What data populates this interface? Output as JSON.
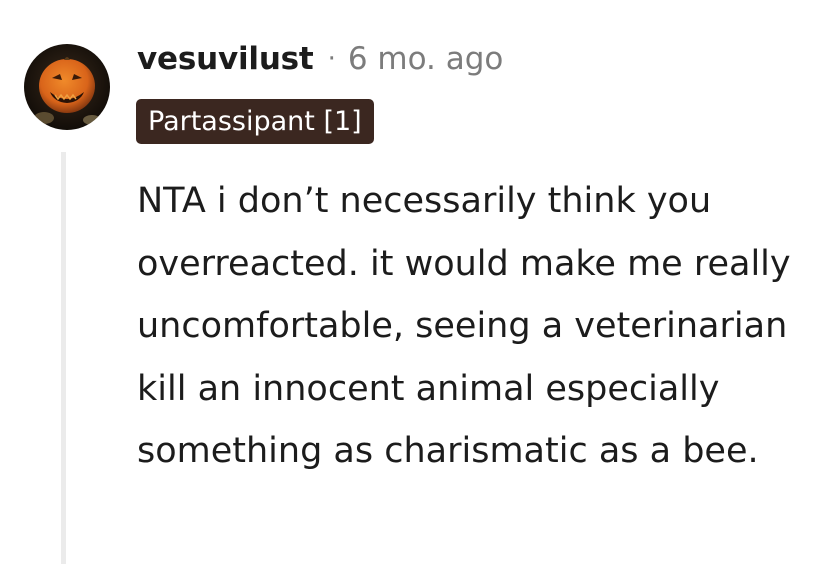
{
  "comment": {
    "username": "vesuvilust",
    "separator": "·",
    "timestamp": "6 mo. ago",
    "flair": "Partassipant [1]",
    "body": "NTA i don’t necessarily think you overreacted. it would make me really uncomfortable, seeing a veterinarian kill an innocent animal especially something as charismatic as a bee."
  },
  "colors": {
    "flair_background": "#3b2720",
    "text": "#1c1c1c",
    "meta": "#7c7c7c",
    "thread_line": "#ebebeb"
  },
  "icons": {
    "avatar": "pumpkin-avatar-icon"
  }
}
